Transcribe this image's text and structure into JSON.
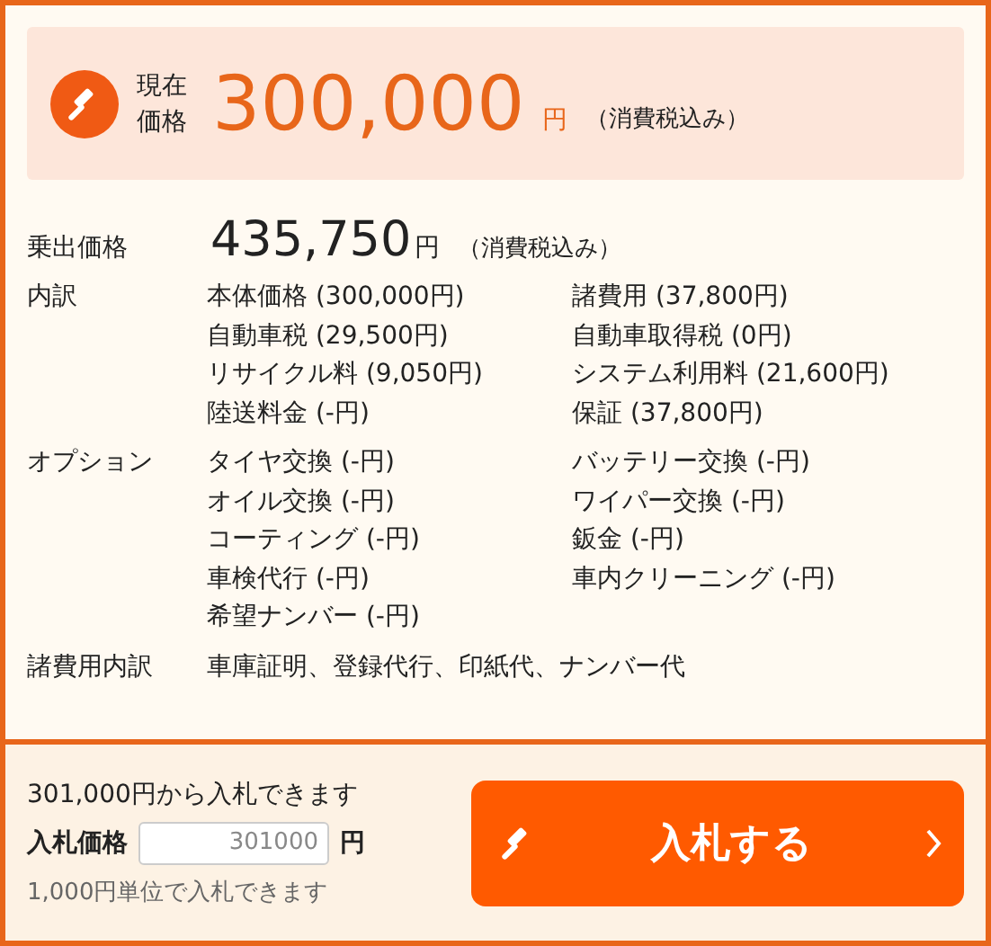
{
  "current_price": {
    "label_lines": [
      "現在",
      "価格"
    ],
    "amount": "300,000",
    "unit": "円",
    "tax_note": "（消費税込み）"
  },
  "total_price": {
    "label": "乗出価格",
    "amount": "435,750",
    "unit": "円",
    "tax_note": "（消費税込み）"
  },
  "sections": [
    {
      "kind": "list",
      "label": "内訳",
      "items": [
        "本体価格 (300,000円)",
        "諸費用 (37,800円)",
        "自動車税 (29,500円)",
        "自動車取得税 (0円)",
        "リサイクル料 (9,050円)",
        "システム利用料 (21,600円)",
        "陸送料金 (-円)",
        "保証 (37,800円)"
      ]
    },
    {
      "kind": "list",
      "label": "オプション",
      "items": [
        "タイヤ交換 (-円)",
        "バッテリー交換 (-円)",
        "オイル交換 (-円)",
        "ワイパー交換 (-円)",
        "コーティング (-円)",
        "鈑金 (-円)",
        "車検代行 (-円)",
        "車内クリーニング (-円)",
        "希望ナンバー (-円)"
      ]
    },
    {
      "kind": "text",
      "label": "諸費用内訳",
      "text": "車庫証明、登録代行、印紙代、ナンバー代"
    }
  ],
  "bid": {
    "minimum_note": "301,000円から入札できます",
    "price_label": "入札価格",
    "placeholder": "301000",
    "unit": "円",
    "unit_note": "1,000円単位で入札できます",
    "button_label": "入札する"
  }
}
